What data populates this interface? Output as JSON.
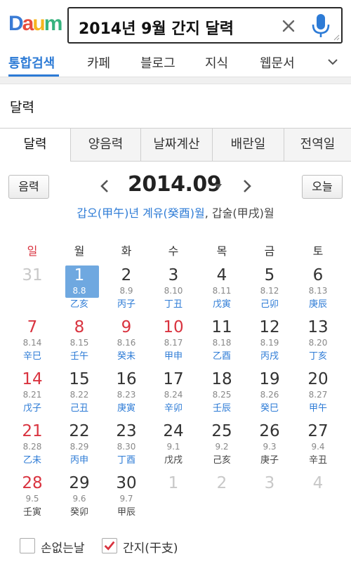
{
  "header": {
    "logo_letters": [
      "D",
      "a",
      "u",
      "m"
    ],
    "logo_colors": [
      "#3a7bd5",
      "#e84c3d",
      "#f6b51e",
      "#36b37e"
    ],
    "search_value": "2014년 9월 간지 달력"
  },
  "nav": {
    "tabs": [
      "통합검색",
      "카페",
      "블로그",
      "지식",
      "웹문서"
    ],
    "active": "통합검색"
  },
  "section_title": "달력",
  "subtabs": [
    "달력",
    "양음력",
    "날짜계산",
    "배란일",
    "전역일"
  ],
  "calendar": {
    "lunar_toggle_label": "음력",
    "today_label": "오늘",
    "month_title": "2014.09",
    "ganji_year": "갑오(甲午)년 계유(癸酉)월",
    "ganji_day": ", 갑술(甲戌)월",
    "weekdays": [
      "일",
      "월",
      "화",
      "수",
      "목",
      "금",
      "토"
    ],
    "weeks": [
      [
        {
          "d": "31",
          "l": "",
          "g": "",
          "t": "other"
        },
        {
          "d": "1",
          "l": "8.8",
          "g": "乙亥",
          "t": "today"
        },
        {
          "d": "2",
          "l": "8.9",
          "g": "丙子",
          "t": ""
        },
        {
          "d": "3",
          "l": "8.10",
          "g": "丁丑",
          "t": ""
        },
        {
          "d": "4",
          "l": "8.11",
          "g": "戊寅",
          "t": ""
        },
        {
          "d": "5",
          "l": "8.12",
          "g": "己卯",
          "t": ""
        },
        {
          "d": "6",
          "l": "8.13",
          "g": "庚辰",
          "t": ""
        }
      ],
      [
        {
          "d": "7",
          "l": "8.14",
          "g": "辛巳",
          "t": "sun"
        },
        {
          "d": "8",
          "l": "8.15",
          "g": "壬午",
          "t": "hol"
        },
        {
          "d": "9",
          "l": "8.16",
          "g": "癸未",
          "t": "hol"
        },
        {
          "d": "10",
          "l": "8.17",
          "g": "甲申",
          "t": "hol"
        },
        {
          "d": "11",
          "l": "8.18",
          "g": "乙酉",
          "t": ""
        },
        {
          "d": "12",
          "l": "8.19",
          "g": "丙戌",
          "t": ""
        },
        {
          "d": "13",
          "l": "8.20",
          "g": "丁亥",
          "t": ""
        }
      ],
      [
        {
          "d": "14",
          "l": "8.21",
          "g": "戊子",
          "t": "sun"
        },
        {
          "d": "15",
          "l": "8.22",
          "g": "己丑",
          "t": ""
        },
        {
          "d": "16",
          "l": "8.23",
          "g": "庚寅",
          "t": ""
        },
        {
          "d": "17",
          "l": "8.24",
          "g": "辛卯",
          "t": ""
        },
        {
          "d": "18",
          "l": "8.25",
          "g": "壬辰",
          "t": ""
        },
        {
          "d": "19",
          "l": "8.26",
          "g": "癸巳",
          "t": ""
        },
        {
          "d": "20",
          "l": "8.27",
          "g": "甲午",
          "t": ""
        }
      ],
      [
        {
          "d": "21",
          "l": "8.28",
          "g": "乙未",
          "t": "sun"
        },
        {
          "d": "22",
          "l": "8.29",
          "g": "丙申",
          "t": ""
        },
        {
          "d": "23",
          "l": "8.30",
          "g": "丁酉",
          "t": ""
        },
        {
          "d": "24",
          "l": "9.1",
          "g": "戊戌",
          "t": "plain"
        },
        {
          "d": "25",
          "l": "9.2",
          "g": "己亥",
          "t": "plain"
        },
        {
          "d": "26",
          "l": "9.3",
          "g": "庚子",
          "t": "plain"
        },
        {
          "d": "27",
          "l": "9.4",
          "g": "辛丑",
          "t": "plain"
        }
      ],
      [
        {
          "d": "28",
          "l": "9.5",
          "g": "壬寅",
          "t": "sun plain"
        },
        {
          "d": "29",
          "l": "9.6",
          "g": "癸卯",
          "t": "plain"
        },
        {
          "d": "30",
          "l": "9.7",
          "g": "甲辰",
          "t": "plain"
        },
        {
          "d": "1",
          "l": "",
          "g": "",
          "t": "other"
        },
        {
          "d": "2",
          "l": "",
          "g": "",
          "t": "other"
        },
        {
          "d": "3",
          "l": "",
          "g": "",
          "t": "other"
        },
        {
          "d": "4",
          "l": "",
          "g": "",
          "t": "other"
        }
      ]
    ]
  },
  "options": {
    "no_bad_day_label": "손없는날",
    "no_bad_day_checked": false,
    "ganji_label": "간지(干支)",
    "ganji_checked": true
  },
  "colors": {
    "accent": "#2d7bd6",
    "sunday": "#d9333f",
    "today_bg": "#6fa8e0"
  }
}
